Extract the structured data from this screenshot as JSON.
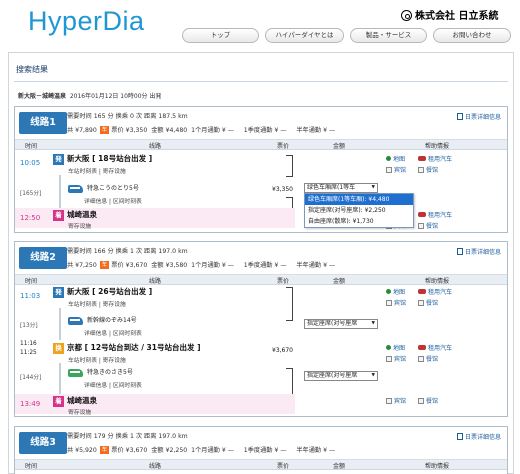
{
  "brand": {
    "logo": "HyperDia",
    "corp": "株式会社 日立系統"
  },
  "nav": [
    "トップ",
    "ハイパーダイヤとは",
    "製品・サービス",
    "お問い合わせ"
  ],
  "page": {
    "title": "搜索结果",
    "condition_route": "新大阪－城崎温泉",
    "condition_date": "2016年01月12日 10時00分 出発"
  },
  "table_headers": {
    "time": "时间",
    "line": "线路",
    "fare": "票价",
    "amount": "金额",
    "info": "帮助情报"
  },
  "routes": [
    {
      "label": "线路1",
      "line1": "需要时间 165 分  换乘 0 次  距离 187.5 km",
      "line2_a": "共 ¥7,890",
      "tag1": "车",
      "line2_b": "票价 ¥3,350",
      "line2_c": "金额 ¥4,480",
      "line2_d": "1个月通勤 ¥ —",
      "line2_e": "1季度通勤 ¥ —",
      "line2_f": "半年通勤 ¥ —",
      "detail": "日票详细信息",
      "dep_time": "10:05",
      "dep_mark": "発",
      "dep_station": "新大阪 [ 18号站台出发 ]",
      "dep_links": "车站时刻表 | 寄存设施",
      "mins": "[165分]",
      "train": "特急こうのとり5号",
      "train_links": "详细信息 | 区间时刻表",
      "fare": "¥3,350",
      "select_value": "绿色车厢席(1等车",
      "arr_time": "12:50",
      "arr_mark": "着",
      "arr_station": "城崎温泉",
      "arr_links": "寄存设施",
      "info_dep": [
        "地图",
        "租用汽车",
        "宾馆",
        "餐馆"
      ],
      "dropdown": [
        "绿色车厢席(1等车厢): ¥4,480",
        "指定座席(对号座席): ¥2,250",
        "自由座席(散席): ¥1,730"
      ]
    },
    {
      "label": "线路2",
      "line1": "需要时间 166 分  换乘 1 次  距离 197.0 km",
      "line2_a": "共 ¥7,250",
      "tag1": "车",
      "line2_b": "票价 ¥3,670",
      "line2_c": "金额 ¥3,580",
      "line2_d": "1个月通勤 ¥ —",
      "line2_e": "1季度通勤 ¥ —",
      "line2_f": "半年通勤 ¥ —",
      "detail": "日票详细信息",
      "dep_time": "11:03",
      "dep_mark": "発",
      "dep_station": "新大阪 [ 26号站台出发 ]",
      "dep_links": "车站时刻表 | 寄存设施",
      "mins1": "[13分]",
      "train1": "新幹線のぞみ14号",
      "train1_links": "详细信息 | 区间时刻表",
      "select1_value": "指定座席(对号座席",
      "tr_time1": "11:16",
      "tr_time2": "11:25",
      "tr_mark": "换",
      "tr_station": "京都 [ 12号站台到达 / 31号站台出发 ]",
      "tr_links": "车站时刻表 | 寄存设施",
      "fare": "¥3,670",
      "mins2": "[144分]",
      "train2": "特急きのさき5号",
      "train2_links": "详细信息 | 区间时刻表",
      "select2_value": "指定座席(对号座席",
      "arr_time": "13:49",
      "arr_mark": "着",
      "arr_station": "城崎温泉",
      "arr_links": "寄存设施",
      "info_dep": [
        "地图",
        "租用汽车",
        "宾馆",
        "餐馆"
      ]
    },
    {
      "label": "线路3",
      "line1": "需要时间 179 分  换乘 1 次  距离 197.0 km",
      "line2_a": "共 ¥5,920",
      "tag1": "车",
      "line2_b": "票价 ¥3,670",
      "line2_c": "金额 ¥2,250",
      "line2_d": "1个月通勤 ¥ —",
      "line2_e": "1季度通勤 ¥ —",
      "line2_f": "半年通勤 ¥ —",
      "detail": "日票详细信息"
    }
  ]
}
